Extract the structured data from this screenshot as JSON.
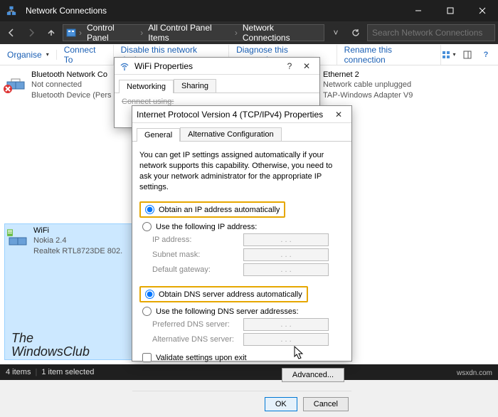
{
  "window": {
    "title": "Network Connections",
    "min_tooltip": "Minimize",
    "max_tooltip": "Maximize",
    "close_tooltip": "Close"
  },
  "breadcrumb": {
    "root_icon": "control-panel-icon",
    "items": [
      "Control Panel",
      "All Control Panel Items",
      "Network Connections"
    ],
    "search_placeholder": "Search Network Connections"
  },
  "toolbar": {
    "organise": "Organise",
    "connect_to": "Connect To",
    "disable": "Disable this network device",
    "diagnose": "Diagnose this connection",
    "rename": "Rename this connection"
  },
  "connections": [
    {
      "name": "Bluetooth Network Co",
      "status": "Not connected",
      "device": "Bluetooth Device (Pers",
      "icon": "bluetooth-icon",
      "disabled_overlay": true
    },
    {
      "name": "Ethernet 2",
      "status": "Network cable unplugged",
      "device": "TAP-Windows Adapter V9",
      "icon": "ethernet-icon",
      "disabled_overlay": true
    },
    {
      "name": "WiFi",
      "status": "Nokia 2.4",
      "device": "Realtek RTL8723DE 802.",
      "icon": "wifi-icon",
      "selected": true
    }
  ],
  "wifi_dialog": {
    "title": "WiFi Properties",
    "tabs": {
      "networking": "Networking",
      "sharing": "Sharing"
    },
    "body_label": "Connect using:"
  },
  "ipv4_dialog": {
    "title": "Internet Protocol Version 4 (TCP/IPv4) Properties",
    "tabs": {
      "general": "General",
      "alt": "Alternative Configuration"
    },
    "description": "You can get IP settings assigned automatically if your network supports this capability. Otherwise, you need to ask your network administrator for the appropriate IP settings.",
    "radio_ip_auto": "Obtain an IP address automatically",
    "radio_ip_manual": "Use the following IP address:",
    "lbl_ip": "IP address:",
    "lbl_subnet": "Subnet mask:",
    "lbl_gateway": "Default gateway:",
    "radio_dns_auto": "Obtain DNS server address automatically",
    "radio_dns_manual": "Use the following DNS server addresses:",
    "lbl_dns_pref": "Preferred DNS server:",
    "lbl_dns_alt": "Alternative DNS server:",
    "chk_validate": "Validate settings upon exit",
    "btn_advanced": "Advanced...",
    "btn_ok": "OK",
    "btn_cancel": "Cancel",
    "ip_placeholder": ".   .   ."
  },
  "statusbar": {
    "items": "4 items",
    "selected": "1 item selected"
  },
  "watermark": {
    "line1": "The",
    "line2": "WindowsClub",
    "wsx": "wsxdn.com"
  }
}
